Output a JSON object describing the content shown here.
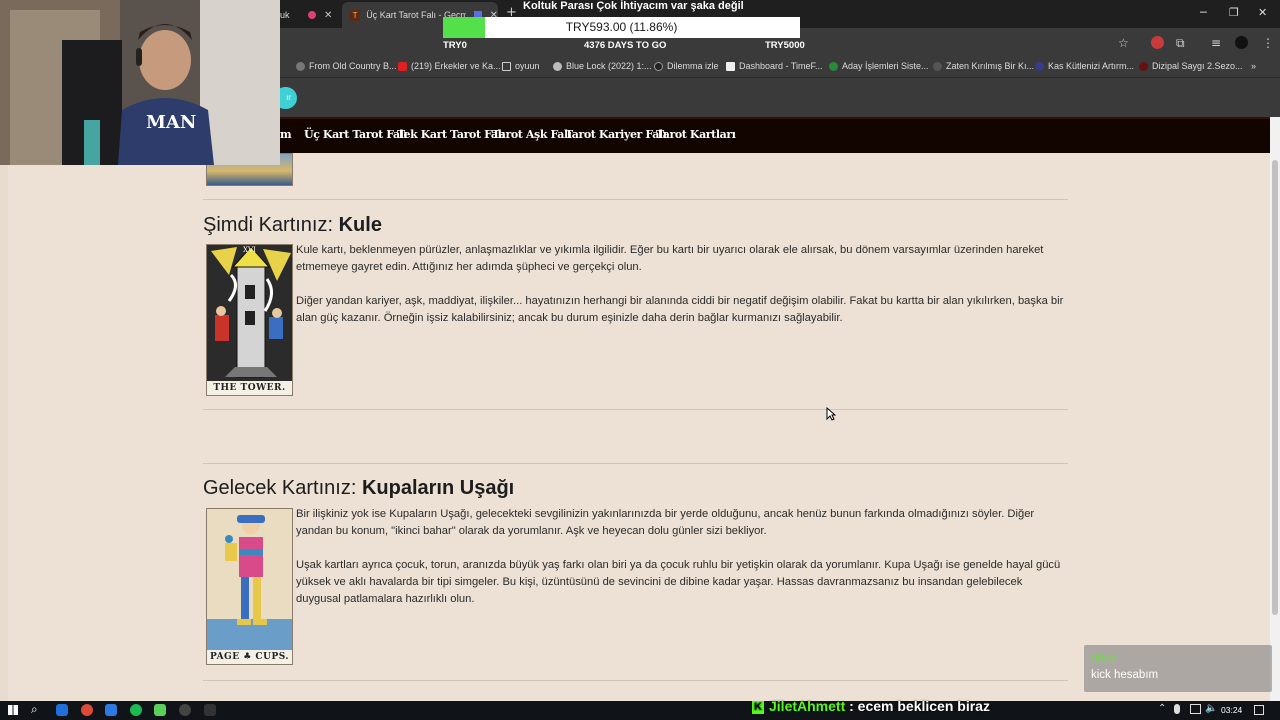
{
  "browser": {
    "tabs": [
      {
        "label": "uk"
      },
      {
        "label": "Üç Kart Tarot Falı - Geçmiş"
      }
    ],
    "active_tab_favicon": "T",
    "bookmarks": [
      "From Old Country B...",
      "(219) Erkekler ve Ka...",
      "oyuun",
      "Blue Lock (2022) 1:...",
      "Dilemma izle",
      "Dashboard - TimeF...",
      "Aday İşlemleri Siste...",
      "Zaten Kırılmış Bir Kı...",
      "Kas Kütlenizi Artırm...",
      "Dizipal Saygı 2.Sezo..."
    ],
    "partial_button_text": "ır"
  },
  "site_nav": {
    "partial_item": "m",
    "items": [
      "Üç Kart Tarot Falı",
      "Tek Kart Tarot Falı",
      "Tarot Aşk Falı",
      "Tarot Kariyer Falı",
      "Tarot Kartları"
    ]
  },
  "sections": [
    {
      "heading_prefix": "Şimdi Kartınız: ",
      "heading_card": "Kule",
      "card_caption": "THE TOWER.",
      "card_number": "XVI",
      "paragraphs": [
        "Kule kartı, beklenmeyen pürüzler, anlaşmazlıklar ve yıkımla ilgilidir. Eğer bu kartı bir uyarıcı olarak ele alırsak, bu dönem varsayımlar üzerinden hareket etmemeye gayret edin. Attığınız her adımda şüpheci ve gerçekçi olun.",
        "Diğer yandan kariyer, aşk, maddiyat, ilişkiler... hayatınızın herhangi bir alanında ciddi bir negatif değişim olabilir. Fakat bu kartta bir alan yıkılırken, başka bir alan güç kazanır. Örneğin işsiz kalabilirsiniz; ancak bu durum eşinizle daha derin bağlar kurmanızı sağlayabilir."
      ]
    },
    {
      "heading_prefix": "Gelecek Kartınız: ",
      "heading_card": "Kupaların Uşağı",
      "card_caption": "PAGE ♣ CUPS.",
      "paragraphs": [
        "Bir ilişkiniz yok ise Kupaların Uşağı, gelecekteki sevgilinizin yakınlarınızda bir yerde olduğunu, ancak henüz bunun farkında olmadığınızı söyler. Diğer yandan bu konum, \"ikinci bahar\" olarak da yorumlanır. Aşk ve heyecan dolu günler sizi bekliyor.",
        "Uşak kartları ayrıca çocuk, torun, aranızda büyük yaş farkı olan biri ya da çocuk ruhlu bir yetişkin olarak da yorumlanır. Kupa Uşağı ise genelde hayal gücü yüksek ve aklı havalarda bir tipi simgeler. Bu kişi, üzüntüsünü de sevincini de dibine kadar yaşar. Hassas davranmazsanız bu insandan gelebilecek duygusal patlamalara hazırlıklı olun."
      ]
    }
  ],
  "stream": {
    "goal_title": "Koltuk Parası Çok İhtiyacım var şaka değil",
    "goal_amount": "TRY593.00 (11.86%)",
    "goal_progress": 0.1186,
    "goal_start": "TRY0",
    "goal_days": "4376 DAYS TO GO",
    "goal_end": "TRY5000",
    "chat_command": "!kick",
    "chat_message": "kick hesabım",
    "ticker_user": "JiletAhmett",
    "ticker_text": " : ecem beklicen biraz",
    "ticker_badge": "K"
  },
  "taskbar": {
    "time": "03:24"
  },
  "colors": {
    "accent_green": "#53e04a",
    "nav_bg": "#120500",
    "page_bg": "#ece1d4",
    "kick_green": "#53fc18"
  }
}
